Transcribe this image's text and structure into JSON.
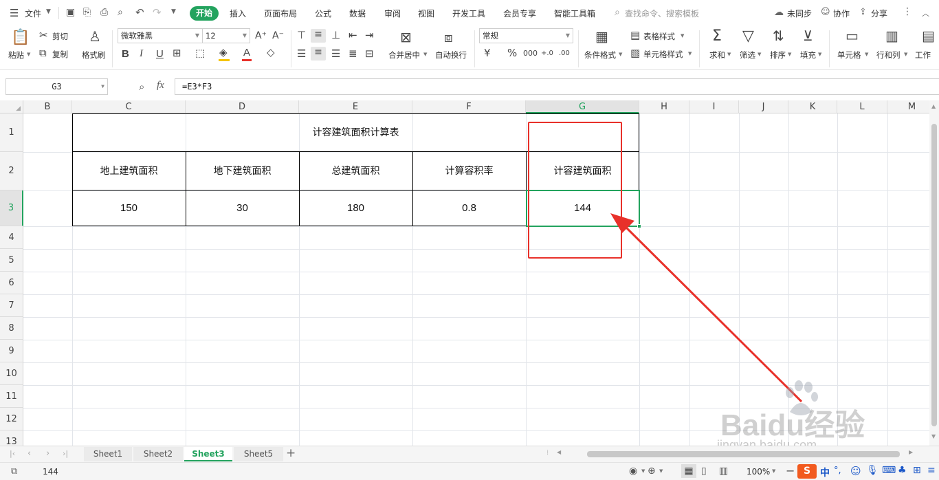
{
  "menubar": {
    "file_label": "文件",
    "tabs": [
      "开始",
      "插入",
      "页面布局",
      "公式",
      "数据",
      "审阅",
      "视图",
      "开发工具",
      "会员专享",
      "智能工具箱"
    ],
    "search_placeholder": "查找命令、搜索模板",
    "sync_label": "未同步",
    "collab_label": "协作",
    "share_label": "分享"
  },
  "ribbon": {
    "paste": "粘贴",
    "cut": "剪切",
    "copy": "复制",
    "format_painter": "格式刷",
    "font_name": "微软雅黑",
    "font_size": "12",
    "merge_center": "合并居中",
    "wrap_text": "自动换行",
    "number_format": "常规",
    "conditional_format": "条件格式",
    "table_style": "表格样式",
    "cell_style": "单元格样式",
    "sum": "求和",
    "filter": "筛选",
    "sort": "排序",
    "fill": "填充",
    "cell": "单元格",
    "row_col": "行和列",
    "worksheet": "工作"
  },
  "formula_bar": {
    "name_box": "G3",
    "fx": "fx",
    "formula": "=E3*F3"
  },
  "grid": {
    "columns": [
      "B",
      "C",
      "D",
      "E",
      "F",
      "G",
      "H",
      "I",
      "J",
      "K",
      "L",
      "M"
    ],
    "rows": [
      "1",
      "2",
      "3",
      "4",
      "5",
      "6",
      "7",
      "8",
      "9",
      "10",
      "11",
      "12",
      "13"
    ],
    "title": "计容建筑面积计算表",
    "headers": [
      "地上建筑面积",
      "地下建筑面积",
      "总建筑面积",
      "计算容积率",
      "计容建筑面积"
    ],
    "values": [
      "150",
      "30",
      "180",
      "0.8",
      "144"
    ]
  },
  "sheet_tabs": [
    "Sheet1",
    "Sheet2",
    "Sheet3",
    "Sheet5"
  ],
  "active_sheet": "Sheet3",
  "status": {
    "cell_value": "144",
    "zoom": "100%"
  },
  "watermark": {
    "brand": "Baidu经验",
    "url": "jingyan.baidu.com"
  },
  "colors": {
    "accent": "#23a35e",
    "annotation": "#e8312a"
  }
}
